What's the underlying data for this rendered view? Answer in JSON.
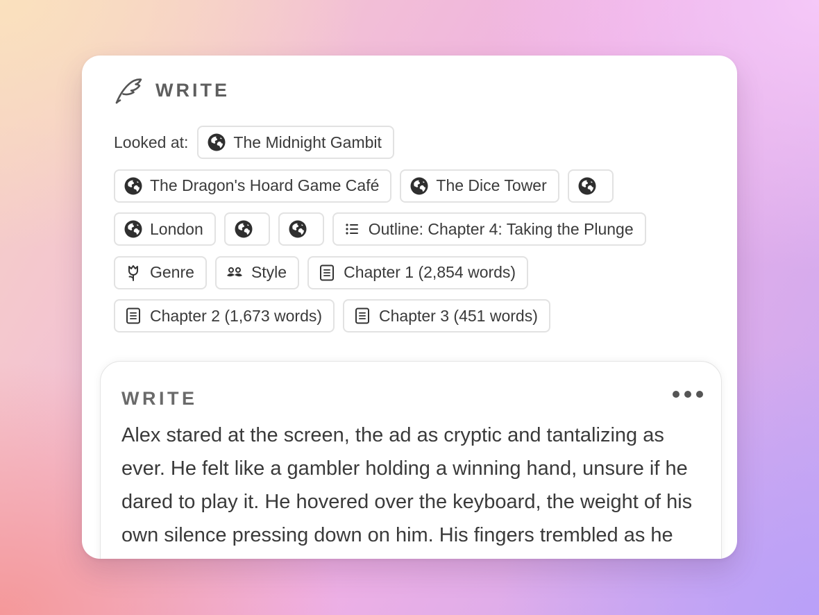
{
  "header": {
    "title": "WRITE",
    "logo_icon": "feather-quill-icon"
  },
  "sources": {
    "label": "Looked at:",
    "chips": [
      {
        "label": "The Midnight Gambit",
        "icon": "globe-icon"
      },
      {
        "label": "The Dragon's Hoard Game Café",
        "icon": "globe-icon"
      },
      {
        "label": "The Dice Tower",
        "icon": "globe-icon"
      },
      {
        "label": "",
        "icon": "globe-icon"
      },
      {
        "label": "London",
        "icon": "globe-icon"
      },
      {
        "label": "",
        "icon": "globe-icon"
      },
      {
        "label": "",
        "icon": "globe-icon"
      },
      {
        "label": "Outline: Chapter 4: Taking the Plunge",
        "icon": "list-icon"
      },
      {
        "label": "Genre",
        "icon": "tulip-icon"
      },
      {
        "label": "Style",
        "icon": "mustache-icon"
      },
      {
        "label": "Chapter 1 (2,854 words)",
        "icon": "document-icon"
      },
      {
        "label": "Chapter 2 (1,673 words)",
        "icon": "document-icon"
      },
      {
        "label": "Chapter 3 (451 words)",
        "icon": "document-icon"
      }
    ]
  },
  "output": {
    "title": "WRITE",
    "more_icon": "more-dots-icon",
    "text": "Alex stared at the screen, the ad as cryptic and tantalizing as ever. He felt like a gambler holding a winning hand, unsure if he dared to play it. He hovered over the keyboard, the weight of his own silence pressing down on him. His fingers trembled as he typed out a response, deleting"
  },
  "colors": {
    "chip_border": "#e2e2e2",
    "text": "#3a3a3a",
    "muted": "#5e5e5e"
  }
}
